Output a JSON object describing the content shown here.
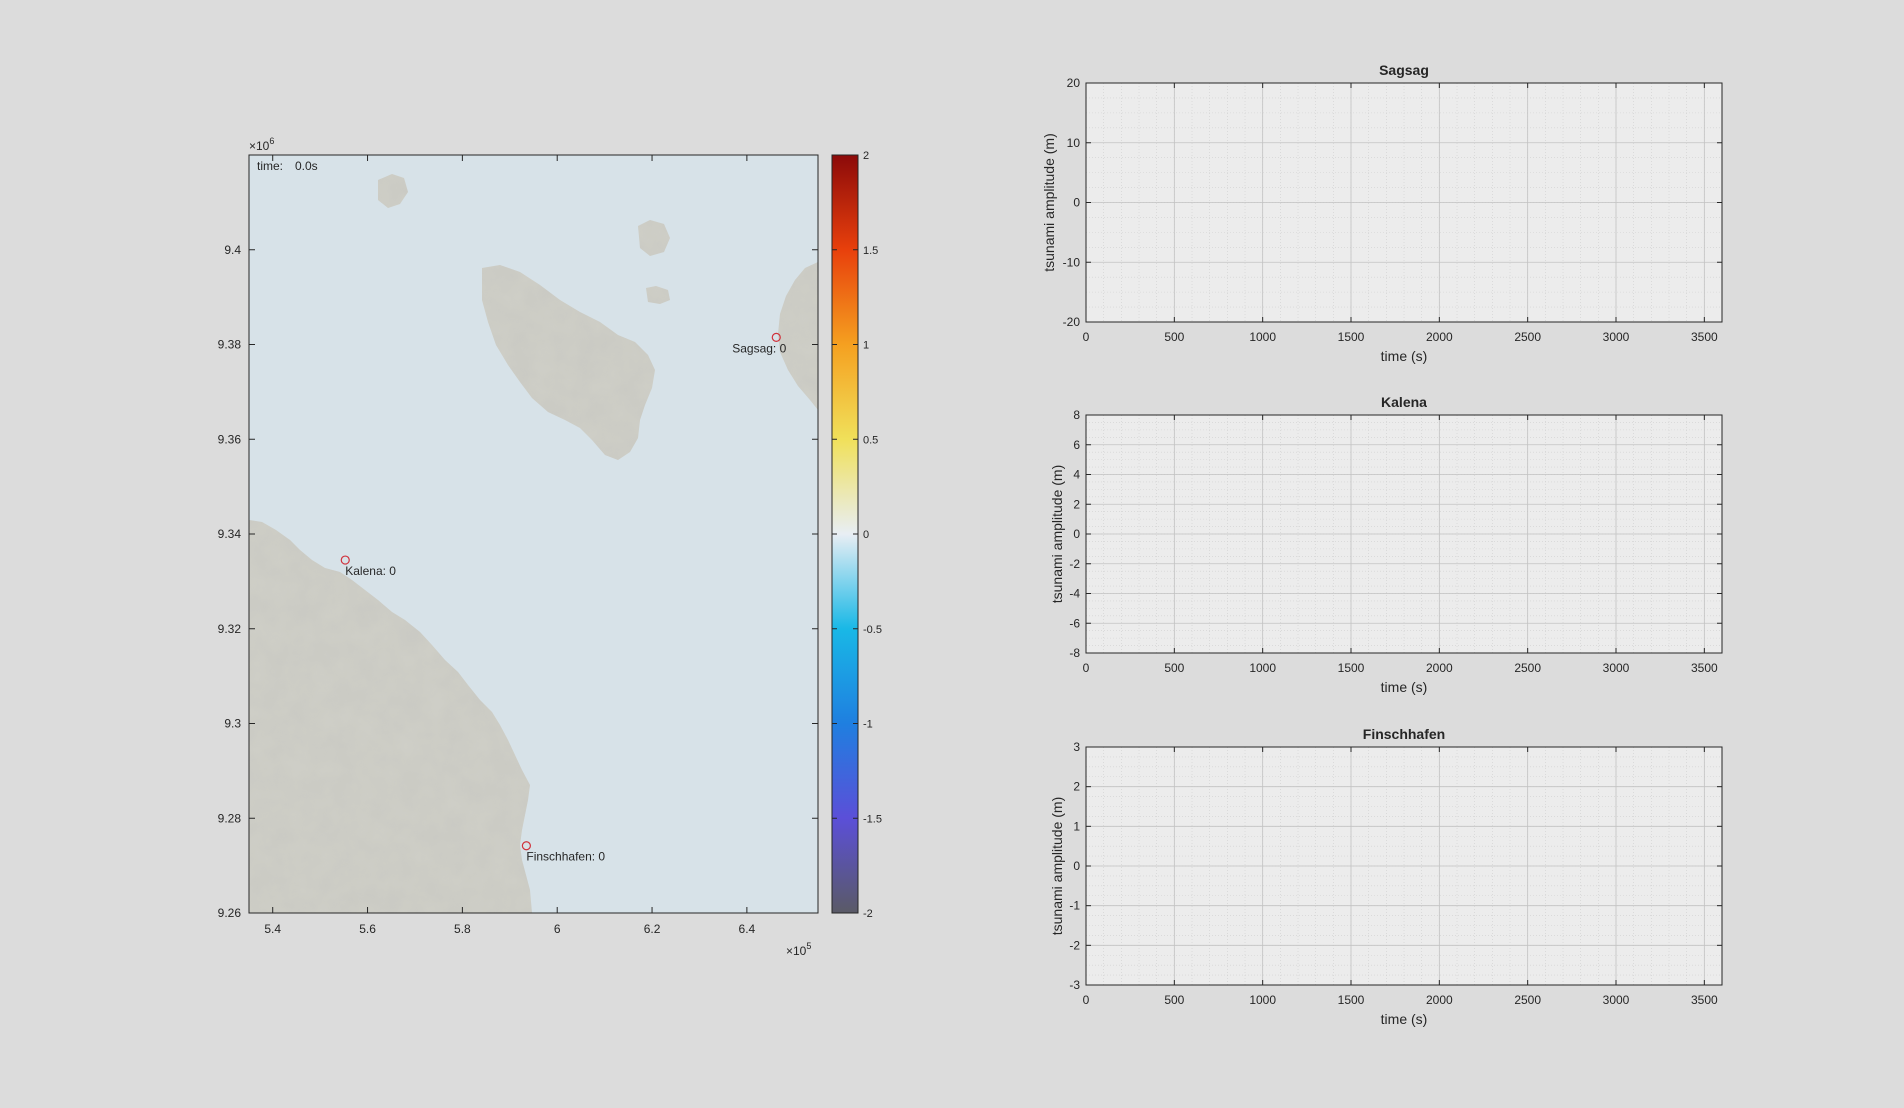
{
  "chart_data": [
    {
      "type": "map",
      "name": "tsunami-map",
      "time_label": "time:",
      "time_value": "0.0s",
      "x_exponent_label": "×10",
      "x_exponent": "5",
      "y_exponent_label": "×10",
      "y_exponent": "6",
      "xlim": [
        5.35,
        6.55
      ],
      "ylim": [
        9.26,
        9.42
      ],
      "xticks": [
        5.4,
        5.6,
        5.8,
        6.0,
        6.2,
        6.4
      ],
      "xtick_labels": [
        "5.4",
        "5.6",
        "5.8",
        "6",
        "6.2",
        "6.4"
      ],
      "yticks": [
        9.26,
        9.28,
        9.3,
        9.32,
        9.34,
        9.36,
        9.38,
        9.4
      ],
      "ytick_labels": [
        "9.26",
        "9.28",
        "9.3",
        "9.32",
        "9.34",
        "9.36",
        "9.38",
        "9.4"
      ],
      "stations": [
        {
          "label": "Sagsag: 0",
          "x": 6.462,
          "y": 9.3815,
          "label_side": "left"
        },
        {
          "label": "Kalena: 0",
          "x": 5.553,
          "y": 9.3345,
          "label_side": "right"
        },
        {
          "label": "Finschhafen: 0",
          "x": 5.935,
          "y": 9.2742,
          "label_side": "right"
        }
      ],
      "colorbar": {
        "lim": [
          -2,
          2
        ],
        "ticks": [
          2,
          1.5,
          1,
          0.5,
          0,
          -0.5,
          -1,
          -1.5,
          -2
        ],
        "tick_labels": [
          "2",
          "1.5",
          "1",
          "0.5",
          "0",
          "-0.5",
          "-1",
          "-1.5",
          "-2"
        ],
        "colors": [
          "#5a5a66",
          "#5b4fd8",
          "#1f7fe0",
          "#19b8e6",
          "#e8eef4",
          "#f0e05a",
          "#f5a020",
          "#e8400c",
          "#8c0a0a"
        ]
      },
      "colors": {
        "sea": "#d7e2e8",
        "land": "#cfcfc7",
        "land_shade": "#b4b4ac",
        "marker": "#d0323c"
      }
    },
    {
      "type": "line",
      "title": "Sagsag",
      "xlabel": "time (s)",
      "ylabel": "tsunami amplitude (m)",
      "xlim": [
        0,
        3600
      ],
      "ylim": [
        -20,
        20
      ],
      "xticks": [
        0,
        500,
        1000,
        1500,
        2000,
        2500,
        3000,
        3500
      ],
      "yticks": [
        -20,
        -10,
        0,
        10,
        20
      ],
      "grid": true,
      "minor_grid": true,
      "series": [
        {
          "x": [],
          "y": []
        }
      ]
    },
    {
      "type": "line",
      "title": "Kalena",
      "xlabel": "time (s)",
      "ylabel": "tsunami amplitude (m)",
      "xlim": [
        0,
        3600
      ],
      "ylim": [
        -8,
        8
      ],
      "xticks": [
        0,
        500,
        1000,
        1500,
        2000,
        2500,
        3000,
        3500
      ],
      "yticks": [
        -8,
        -6,
        -4,
        -2,
        0,
        2,
        4,
        6,
        8
      ],
      "grid": true,
      "minor_grid": true,
      "series": [
        {
          "x": [],
          "y": []
        }
      ]
    },
    {
      "type": "line",
      "title": "Finschhafen",
      "xlabel": "time (s)",
      "ylabel": "tsunami amplitude (m)",
      "xlim": [
        0,
        3600
      ],
      "ylim": [
        -3,
        3
      ],
      "xticks": [
        0,
        500,
        1000,
        1500,
        2000,
        2500,
        3000,
        3500
      ],
      "yticks": [
        -3,
        -2,
        -1,
        0,
        1,
        2,
        3
      ],
      "grid": true,
      "minor_grid": true,
      "series": [
        {
          "x": [],
          "y": []
        }
      ]
    }
  ]
}
